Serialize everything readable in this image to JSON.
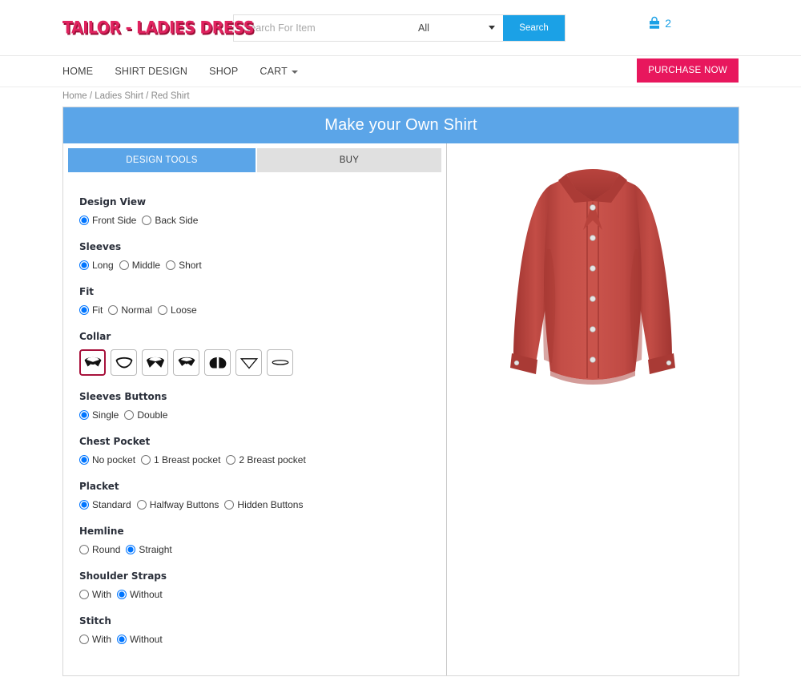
{
  "header": {
    "logo_text": "TAILOR - LADIES DRESS",
    "search": {
      "placeholder": "Search For Item",
      "value": "",
      "category_selected": "All",
      "category_options": [
        "All"
      ],
      "button_label": "Search"
    },
    "cart": {
      "icon": "shopping-bag-icon",
      "count": "2",
      "color": "#1ba1e6"
    }
  },
  "nav": {
    "items": [
      {
        "label": "HOME",
        "has_chevron": false
      },
      {
        "label": "SHIRT DESIGN",
        "has_chevron": false
      },
      {
        "label": "SHOP",
        "has_chevron": false
      },
      {
        "label": "CART",
        "has_chevron": true
      }
    ],
    "purchase_label": "PURCHASE NOW",
    "purchase_color": "#e8175d"
  },
  "breadcrumb": {
    "text": "Home / Ladies Shirt / Red Shirt"
  },
  "panel": {
    "title": "Make your Own Shirt",
    "title_bg": "#5ba5e8",
    "tabs": [
      {
        "label": "DESIGN TOOLS",
        "active": true
      },
      {
        "label": "BUY",
        "active": false
      }
    ]
  },
  "form": {
    "groups": [
      {
        "label": "Design View",
        "type": "radio",
        "options": [
          {
            "label": "Front Side",
            "selected": true
          },
          {
            "label": "Back Side",
            "selected": false
          }
        ]
      },
      {
        "label": "Sleeves",
        "type": "radio",
        "options": [
          {
            "label": "Long",
            "selected": true
          },
          {
            "label": "Middle",
            "selected": false
          },
          {
            "label": "Short",
            "selected": false
          }
        ]
      },
      {
        "label": "Fit",
        "type": "radio",
        "options": [
          {
            "label": "Fit",
            "selected": true
          },
          {
            "label": "Normal",
            "selected": false
          },
          {
            "label": "Loose",
            "selected": false
          }
        ]
      },
      {
        "label": "Collar",
        "type": "icons",
        "selected_index": 0,
        "selected_border": "#a8123c",
        "options": [
          {
            "icon": "collar-spread-icon",
            "selected": true
          },
          {
            "icon": "collar-open-icon",
            "selected": false
          },
          {
            "icon": "collar-wide-spread-icon",
            "selected": false
          },
          {
            "icon": "collar-button-down-icon",
            "selected": false
          },
          {
            "icon": "collar-round-icon",
            "selected": false
          },
          {
            "icon": "collar-v-neck-icon",
            "selected": false
          },
          {
            "icon": "collar-band-icon",
            "selected": false
          }
        ]
      },
      {
        "label": "Sleeves Buttons",
        "type": "radio",
        "options": [
          {
            "label": "Single",
            "selected": true
          },
          {
            "label": "Double",
            "selected": false
          }
        ]
      },
      {
        "label": "Chest Pocket",
        "type": "radio",
        "options": [
          {
            "label": "No pocket",
            "selected": true
          },
          {
            "label": "1 Breast pocket",
            "selected": false
          },
          {
            "label": "2 Breast pocket",
            "selected": false
          }
        ]
      },
      {
        "label": "Placket",
        "type": "radio",
        "options": [
          {
            "label": "Standard",
            "selected": true
          },
          {
            "label": "Halfway Buttons",
            "selected": false
          },
          {
            "label": "Hidden Buttons",
            "selected": false
          }
        ]
      },
      {
        "label": "Hemline",
        "type": "radio",
        "options": [
          {
            "label": "Round",
            "selected": false
          },
          {
            "label": "Straight",
            "selected": true
          }
        ]
      },
      {
        "label": "Shoulder Straps",
        "type": "radio",
        "options": [
          {
            "label": "With",
            "selected": false
          },
          {
            "label": "Without",
            "selected": true
          }
        ]
      },
      {
        "label": "Stitch",
        "type": "radio",
        "options": [
          {
            "label": "With",
            "selected": false
          },
          {
            "label": "Without",
            "selected": true
          }
        ]
      }
    ]
  },
  "preview": {
    "name": "shirt-preview",
    "garment": "ladies long-sleeve button-up shirt",
    "color": "#bf4540",
    "color_dark": "#9c332f",
    "color_light": "#d0564f",
    "button_color": "#e6e6e6",
    "button_count": "7"
  }
}
